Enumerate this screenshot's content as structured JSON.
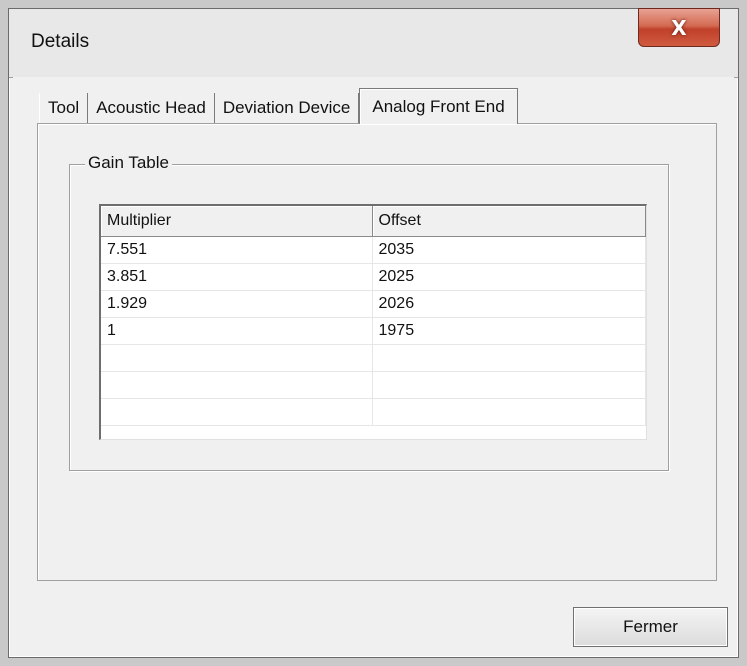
{
  "window": {
    "title": "Details",
    "close_label": "X"
  },
  "tabs": [
    {
      "label": "Tool",
      "active": false
    },
    {
      "label": "Acoustic Head",
      "active": false
    },
    {
      "label": "Deviation Device",
      "active": false
    },
    {
      "label": "Analog Front End",
      "active": true
    }
  ],
  "gain_table": {
    "title": "Gain Table",
    "columns": [
      "Multiplier",
      "Offset"
    ],
    "rows": [
      [
        "7.551",
        "2035"
      ],
      [
        "3.851",
        "2025"
      ],
      [
        "1.929",
        "2026"
      ],
      [
        "1",
        "1975"
      ],
      [
        "",
        ""
      ],
      [
        "",
        ""
      ],
      [
        "",
        ""
      ]
    ]
  },
  "footer": {
    "close_button_label": "Fermer"
  }
}
